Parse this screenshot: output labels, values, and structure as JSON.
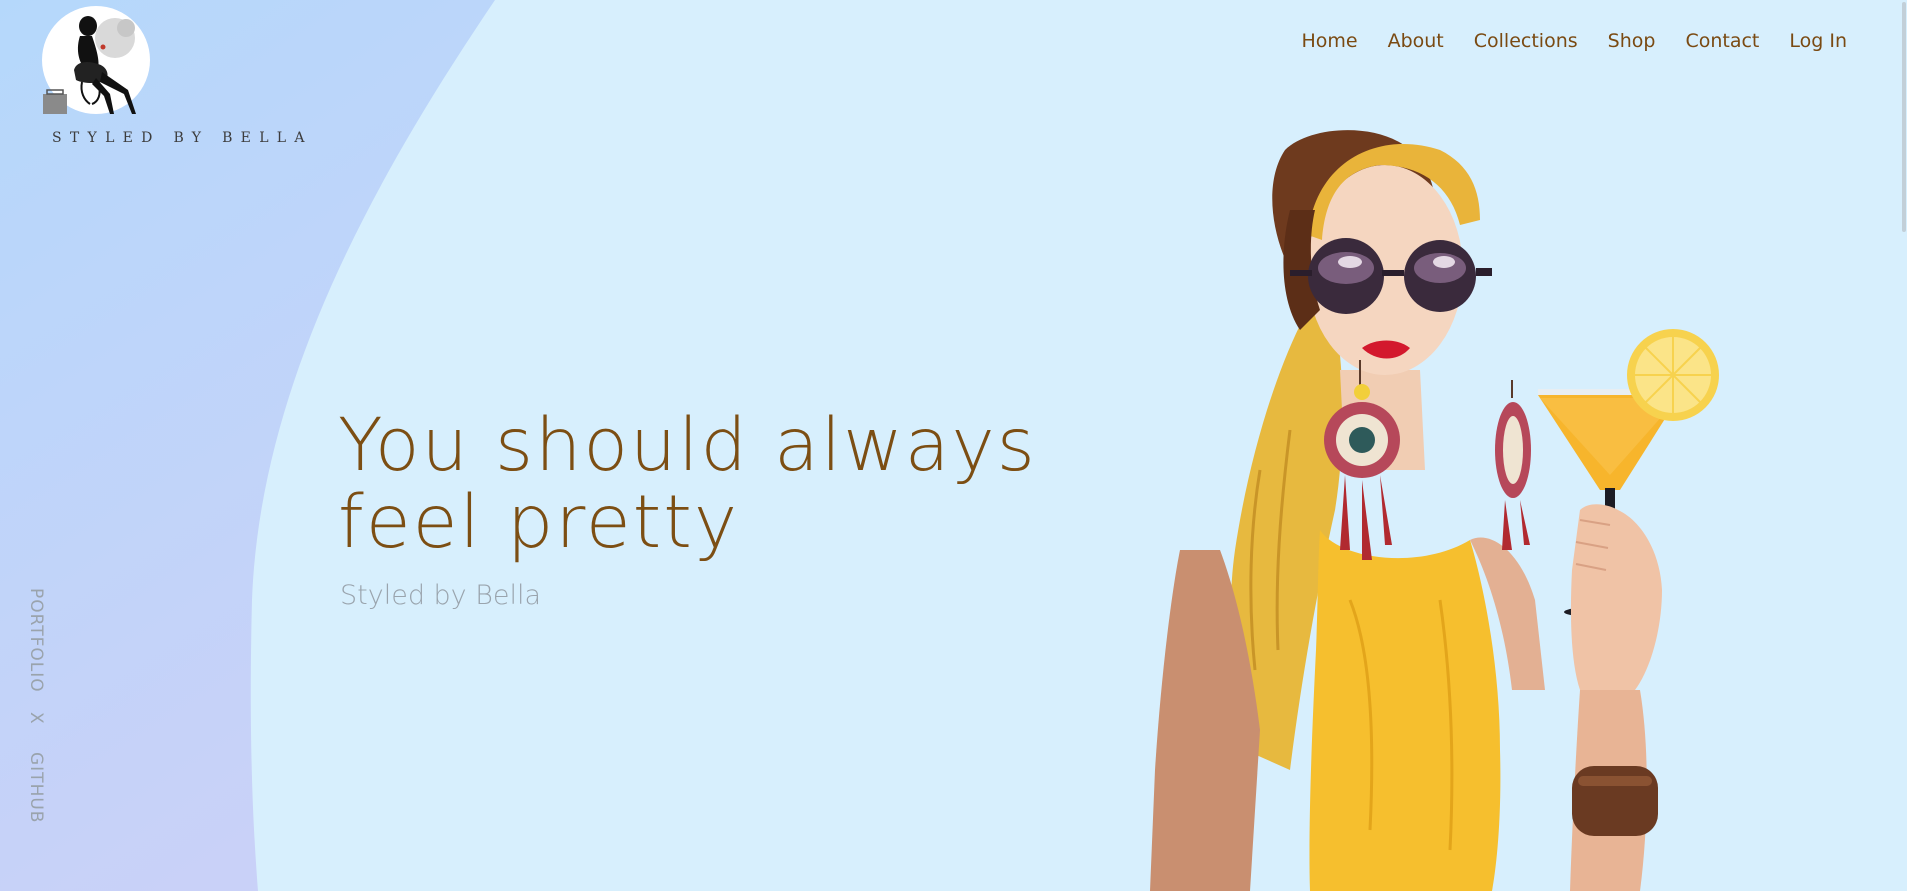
{
  "brand": {
    "name": "STYLED BY BELLA"
  },
  "nav": {
    "items": [
      "Home",
      "About",
      "Collections",
      "Shop",
      "Contact",
      "Log In"
    ]
  },
  "hero": {
    "title_line1": "You should always",
    "title_line2": "feel pretty",
    "subtitle": "Styled by Bella"
  },
  "side_links": {
    "portfolio": "PORTFOLIO",
    "separator": "X",
    "github": "GITHUB"
  },
  "colors": {
    "background": "#d7effd",
    "accent_text": "#7c4e13",
    "muted_text": "#9aa4ad",
    "shirt_yellow": "#f6bf2e"
  }
}
